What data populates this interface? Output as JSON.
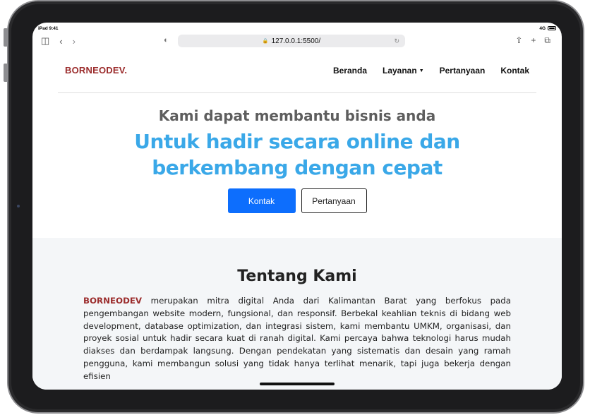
{
  "status": {
    "time": "iPad 9:41",
    "network": "4G"
  },
  "browser": {
    "url": "127.0.0.1:5500/"
  },
  "nav": {
    "brand": "BORNEODEV.",
    "items": [
      {
        "label": "Beranda"
      },
      {
        "label": "Layanan"
      },
      {
        "label": "Pertanyaan"
      },
      {
        "label": "Kontak"
      }
    ]
  },
  "hero": {
    "subtitle": "Kami dapat membantu bisnis anda",
    "title_line1": "Untuk hadir secara online dan",
    "title_line2": "berkembang dengan cepat",
    "primary_button": "Kontak",
    "secondary_button": "Pertanyaan"
  },
  "about": {
    "title": "Tentang Kami",
    "highlight": "BORNEODEV",
    "body": "merupakan mitra digital Anda dari Kalimantan Barat yang berfokus pada pengembangan website modern, fungsional, dan responsif. Berbekal keahlian teknis di bidang web development, database optimization, dan integrasi sistem, kami membantu UMKM, organisasi, dan proyek sosial untuk hadir secara kuat di ranah digital. Kami percaya bahwa teknologi harus mudah diakses dan berdampak langsung. Dengan pendekatan yang sistematis dan desain yang ramah pengguna, kami membangun solusi yang tidak hanya terlihat menarik, tapi juga bekerja dengan efisien"
  },
  "colors": {
    "brand": "#9b2c2c",
    "hero_title": "#3aa8e8",
    "primary": "#0d6efd"
  }
}
